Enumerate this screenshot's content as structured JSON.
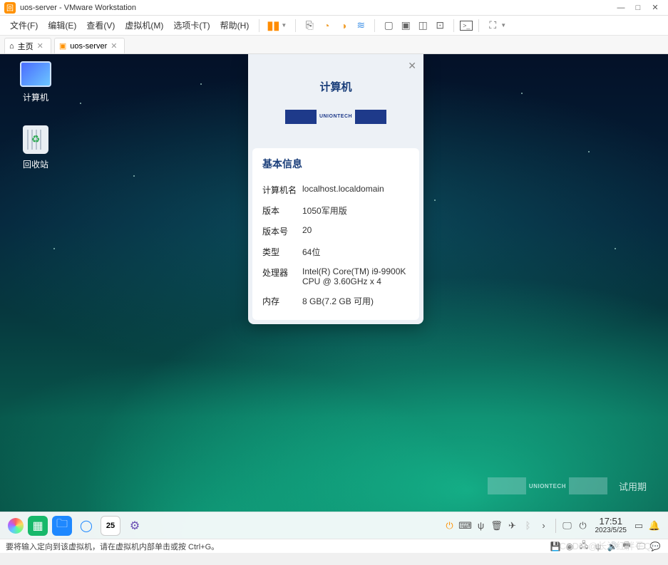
{
  "window": {
    "title": "uos-server - VMware Workstation",
    "controls": {
      "min": "—",
      "max": "□",
      "close": "✕"
    }
  },
  "menu": {
    "file": "文件(F)",
    "edit": "编辑(E)",
    "view": "查看(V)",
    "vm": "虚拟机(M)",
    "tabs": "选项卡(T)",
    "help": "帮助(H)"
  },
  "tabs": {
    "home": "主页",
    "vm_name": "uos-server"
  },
  "desktop": {
    "computer": "计算机",
    "trash": "回收站"
  },
  "dialog": {
    "title": "计算机",
    "logo_text": "UNIONTECH",
    "section": "基本信息",
    "rows": {
      "hostname_k": "计算机名",
      "hostname_v": "localhost.localdomain",
      "version_k": "版本",
      "version_v": "1050军用版",
      "build_k": "版本号",
      "build_v": "20",
      "type_k": "类型",
      "type_v": "64位",
      "cpu_k": "处理器",
      "cpu_v": "Intel(R) Core(TM) i9-9900K CPU @ 3.60GHz x 4",
      "mem_k": "内存",
      "mem_v": "8 GB(7.2 GB 可用)"
    }
  },
  "watermark": {
    "logo": "UNIONTECH",
    "label": "试用期"
  },
  "taskbar": {
    "calendar_day": "25",
    "time": "17:51",
    "date": "2023/5/25"
  },
  "statusbar": {
    "hint": "要将输入定向到该虚拟机，请在虚拟机内部单击或按 Ctrl+G。"
  },
  "csdn": "CSDN @长沙红胖子Qt"
}
